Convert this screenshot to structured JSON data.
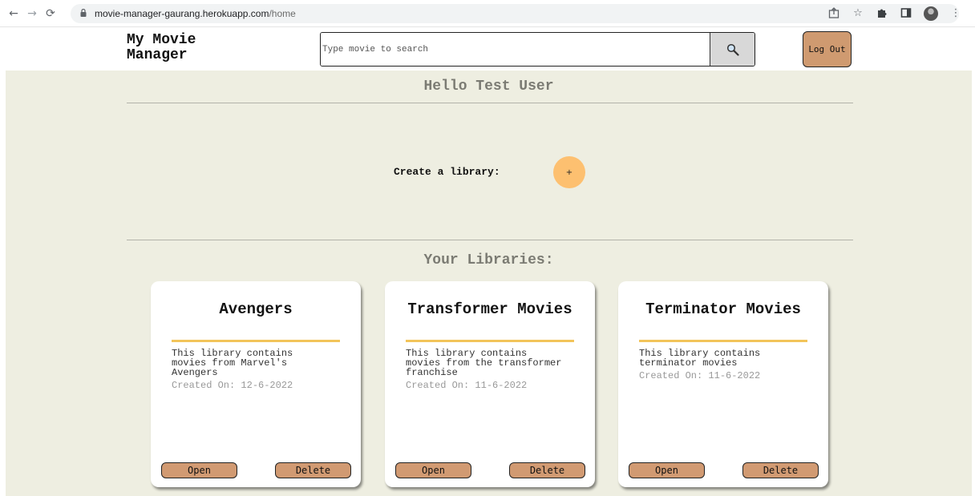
{
  "browser": {
    "url_host": "movie-manager-gaurang.herokuapp.com",
    "url_path": "/home",
    "nav_icons": [
      "back-icon",
      "forward-icon",
      "reload-icon"
    ],
    "toolbar_icons": [
      "share-icon",
      "bookmark-star-icon",
      "extensions-puzzle-icon",
      "side-panel-icon",
      "profile-avatar",
      "menu-kebab-icon"
    ]
  },
  "header": {
    "brand": "My Movie Manager",
    "search_placeholder": "Type movie to search",
    "search_value": "",
    "logout_label": "Log Out"
  },
  "main": {
    "greeting": "Hello Test User",
    "create_label": "Create a library:",
    "add_label": "+",
    "libraries_title": "Your Libraries:",
    "libraries": [
      {
        "title": "Avengers",
        "description": "This library contains movies from Marvel's Avengers",
        "created": "Created On: 12-6-2022",
        "open_label": "Open",
        "delete_label": "Delete"
      },
      {
        "title": "Transformer Movies",
        "description": "This library contains movies from the transformer franchise",
        "created": "Created On: 11-6-2022",
        "open_label": "Open",
        "delete_label": "Delete"
      },
      {
        "title": "Terminator Movies",
        "description": "This library contains terminator movies",
        "created": "Created On: 11-6-2022",
        "open_label": "Open",
        "delete_label": "Delete"
      }
    ]
  },
  "colors": {
    "page_background": "#eeeee1",
    "button_brown": "#d19a72",
    "add_button": "#fdc070",
    "card_rule": "#f2c45a"
  }
}
